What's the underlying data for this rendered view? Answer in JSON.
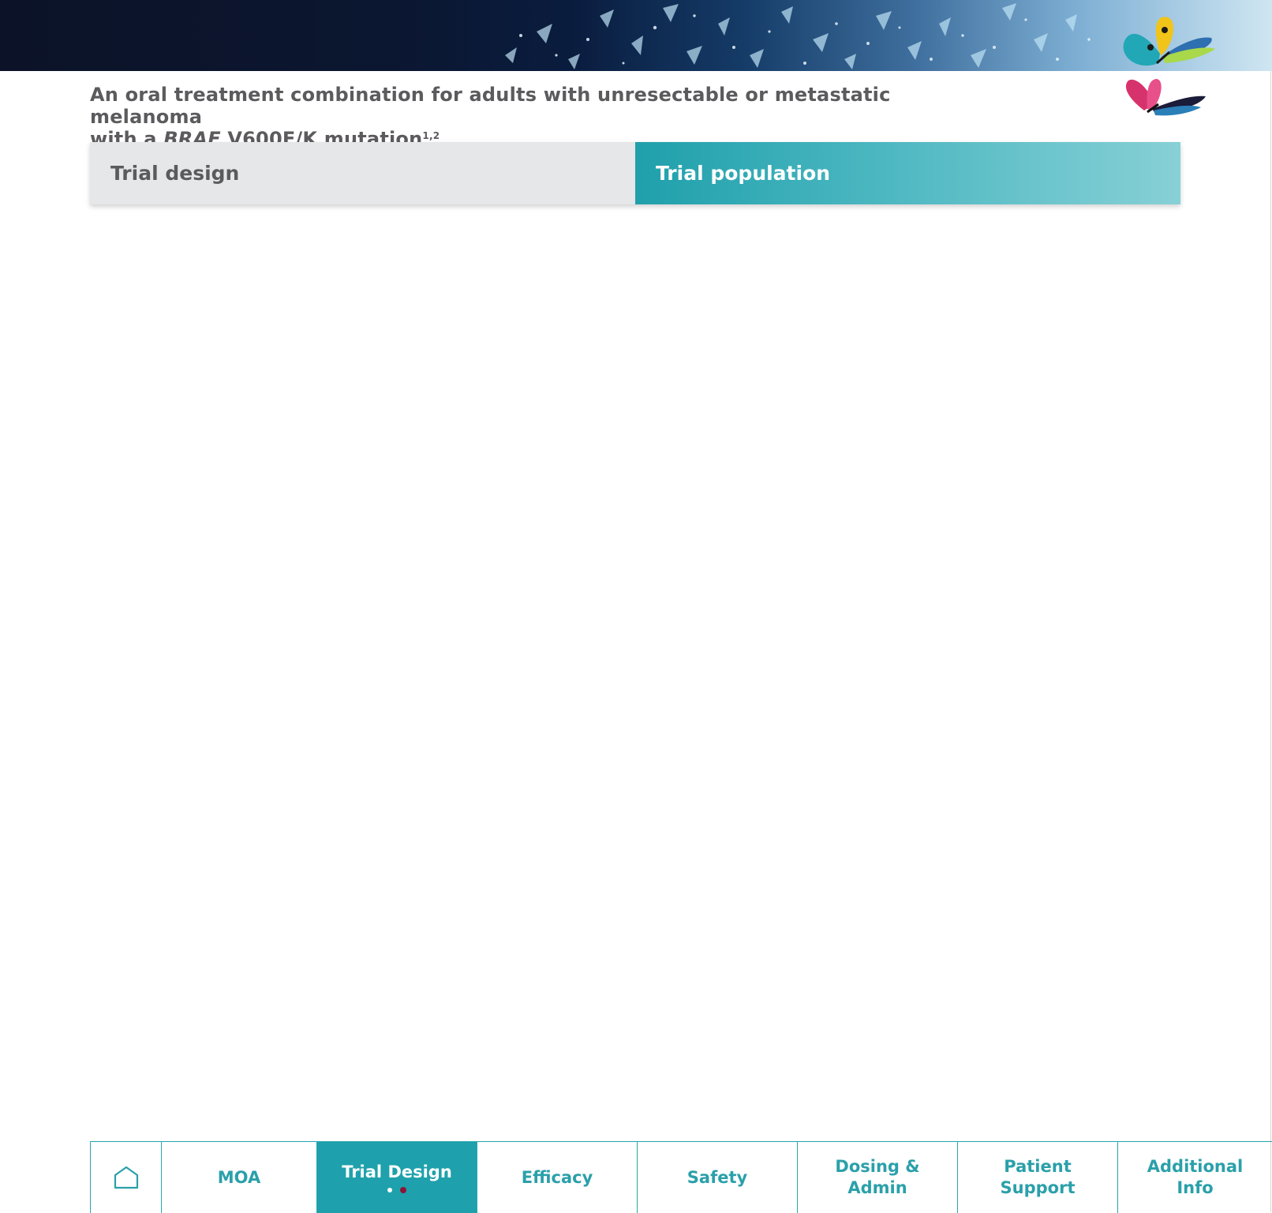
{
  "header": {
    "tagline_line1": "An oral treatment combination for adults with unresectable or metastatic melanoma",
    "tagline_line2_prefix": "with a ",
    "tagline_gene": "BRAF",
    "tagline_line2_suffix": " V600E/K mutation",
    "tagline_refs": "1,2"
  },
  "tabs": [
    {
      "label": "Trial design",
      "active": false
    },
    {
      "label": "Trial population",
      "active": true
    }
  ],
  "bottom_nav": {
    "home_icon": "home-icon",
    "items": [
      {
        "line1": "MOA",
        "line2": ""
      },
      {
        "line1": "Trial Design",
        "line2": "",
        "active": true
      },
      {
        "line1": "Efficacy",
        "line2": ""
      },
      {
        "line1": "Safety",
        "line2": ""
      },
      {
        "line1": "Dosing &",
        "line2": "Admin"
      },
      {
        "line1": "Patient",
        "line2": "Support"
      },
      {
        "line1": "Additional",
        "line2": "Info"
      }
    ],
    "page_indicator": {
      "pages": 2,
      "current": 2
    }
  },
  "colors": {
    "teal": "#1ea1ac",
    "grey_text": "#5b5b5e",
    "tab_grey": "#e6e7e8",
    "indicator_red": "#8a1538",
    "banner_dark": "#0c1328"
  }
}
